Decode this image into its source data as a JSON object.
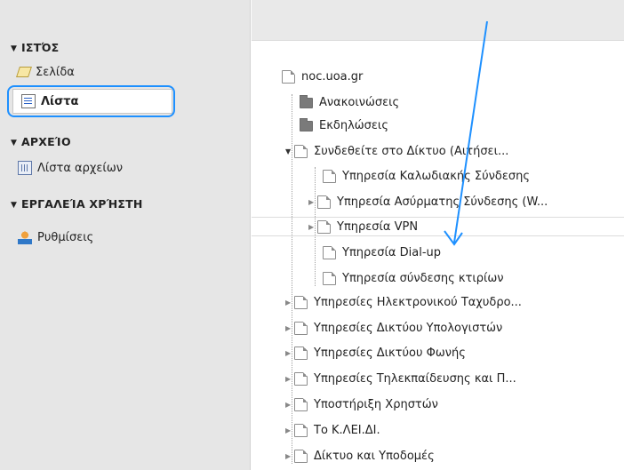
{
  "sidebar": {
    "sections": [
      {
        "title": "ΙΣΤΌΣ",
        "items": [
          {
            "label": "Σελίδα",
            "icon": "pencil-icon"
          },
          {
            "label": "Λίστα",
            "icon": "list-icon",
            "active": true
          }
        ]
      },
      {
        "title": "ΑΡΧΕΊΟ",
        "items": [
          {
            "label": "Λίστα αρχείων",
            "icon": "files-icon"
          }
        ]
      },
      {
        "title": "ΕΡΓΑΛΕΊΑ ΧΡΉΣΤΗ",
        "items": [
          {
            "label": "Ρυθμίσεις",
            "icon": "user-settings-icon"
          }
        ]
      }
    ]
  },
  "tree": {
    "root": "noc.uoa.gr",
    "items": [
      {
        "label": "Ανακοινώσεις",
        "type": "folder"
      },
      {
        "label": "Εκδηλώσεις",
        "type": "folder"
      },
      {
        "label": "Συνδεθείτε στο Δίκτυο (Αιτήσει...",
        "type": "page",
        "expanded": true
      },
      {
        "label": "Υπηρεσία Καλωδιακής Σύνδεσης",
        "type": "page"
      },
      {
        "label": "Υπηρεσία Ασύρματης Σύνδεσης (W...",
        "type": "page",
        "expandable": true
      },
      {
        "label": "Υπηρεσία VPN",
        "type": "page",
        "expandable": true,
        "hovered": true
      },
      {
        "label": "Υπηρεσία Dial-up",
        "type": "page"
      },
      {
        "label": "Υπηρεσία σύνδεσης κτιρίων",
        "type": "page"
      },
      {
        "label": "Υπηρεσίες Ηλεκτρονικού Ταχυδρο...",
        "type": "page",
        "expandable": true
      },
      {
        "label": "Υπηρεσίες Δικτύου Υπολογιστών",
        "type": "page",
        "expandable": true
      },
      {
        "label": "Υπηρεσίες Δικτύου Φωνής",
        "type": "page",
        "expandable": true
      },
      {
        "label": "Υπηρεσίες Τηλεκπαίδευσης και Π...",
        "type": "page",
        "expandable": true
      },
      {
        "label": "Υποστήριξη Χρηστών",
        "type": "page",
        "expandable": true
      },
      {
        "label": "Το Κ.ΛΕΙ.ΔΙ.",
        "type": "page",
        "expandable": true
      },
      {
        "label": "Δίκτυο και Υποδομές",
        "type": "page",
        "expandable": true
      }
    ]
  },
  "colors": {
    "sidebar_bg": "#e6e6e6",
    "highlight": "#1e90ff",
    "annotation_arrow": "#1e90ff"
  }
}
